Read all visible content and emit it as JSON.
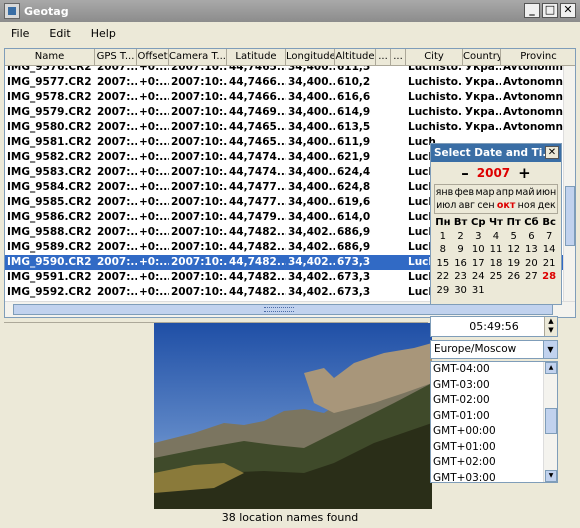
{
  "window": {
    "title": "Geotag",
    "minimize": "_",
    "maximize": "□",
    "close": "✕"
  },
  "menu": [
    "File",
    "Edit",
    "Help"
  ],
  "table": {
    "columns": [
      "Name",
      "GPS T...",
      "Offset",
      "Camera T...",
      "Latitude",
      "Longitude",
      "Altitude",
      "...",
      "...",
      "City",
      "Country",
      "Provinc"
    ],
    "rows": [
      [
        "IMG_9576.CR2",
        "2007:...",
        "+0:...",
        "2007:10:...",
        "44,7465...",
        "34,400...",
        "611,5",
        "",
        "",
        "Luchisto...",
        "Укра...",
        "Avtonomn"
      ],
      [
        "IMG_9577.CR2",
        "2007:...",
        "+0:...",
        "2007:10:...",
        "44,7466...",
        "34,400...",
        "610,2",
        "",
        "",
        "Luchisto...",
        "Укра...",
        "Avtonomn"
      ],
      [
        "IMG_9578.CR2",
        "2007:...",
        "+0:...",
        "2007:10:...",
        "44,7466...",
        "34,400...",
        "616,6",
        "",
        "",
        "Luchisto...",
        "Укра...",
        "Avtonomn"
      ],
      [
        "IMG_9579.CR2",
        "2007:...",
        "+0:...",
        "2007:10:...",
        "44,7469...",
        "34,400...",
        "614,9",
        "",
        "",
        "Luchisto...",
        "Укра...",
        "Avtonomn"
      ],
      [
        "IMG_9580.CR2",
        "2007:...",
        "+0:...",
        "2007:10:...",
        "44,7465...",
        "34,400...",
        "613,5",
        "",
        "",
        "Luchisto...",
        "Укра...",
        "Avtonomn"
      ],
      [
        "IMG_9581.CR2",
        "2007:...",
        "+0:...",
        "2007:10:...",
        "44,7465...",
        "34,400...",
        "611,9",
        "",
        "",
        "Luch",
        "",
        ""
      ],
      [
        "IMG_9582.CR2",
        "2007:...",
        "+0:...",
        "2007:10:...",
        "44,7474...",
        "34,400...",
        "621,9",
        "",
        "",
        "Luch",
        "",
        ""
      ],
      [
        "IMG_9583.CR2",
        "2007:...",
        "+0:...",
        "2007:10:...",
        "44,7474...",
        "34,400...",
        "624,4",
        "",
        "",
        "Luch",
        "",
        ""
      ],
      [
        "IMG_9584.CR2",
        "2007:...",
        "+0:...",
        "2007:10:...",
        "44,7477...",
        "34,400...",
        "624,8",
        "",
        "",
        "Luch",
        "",
        ""
      ],
      [
        "IMG_9585.CR2",
        "2007:...",
        "+0:...",
        "2007:10:...",
        "44,7477...",
        "34,400...",
        "619,6",
        "",
        "",
        "Luch",
        "",
        ""
      ],
      [
        "IMG_9586.CR2",
        "2007:...",
        "+0:...",
        "2007:10:...",
        "44,7479...",
        "34,400...",
        "614,0",
        "",
        "",
        "Luch",
        "",
        ""
      ],
      [
        "IMG_9588.CR2",
        "2007:...",
        "+0:...",
        "2007:10:...",
        "44,7482...",
        "34,402...",
        "686,9",
        "",
        "",
        "Luch",
        "",
        ""
      ],
      [
        "IMG_9589.CR2",
        "2007:...",
        "+0:...",
        "2007:10:...",
        "44,7482...",
        "34,402...",
        "686,9",
        "",
        "",
        "Luch",
        "",
        ""
      ],
      [
        "IMG_9590.CR2",
        "2007:...",
        "+0:...",
        "2007:10:...",
        "44,7482...",
        "34,402...",
        "673,3",
        "",
        "",
        "Luch",
        "",
        ""
      ],
      [
        "IMG_9591.CR2",
        "2007:...",
        "+0:...",
        "2007:10:...",
        "44,7482...",
        "34,402...",
        "673,3",
        "",
        "",
        "Luch",
        "",
        ""
      ],
      [
        "IMG_9592.CR2",
        "2007:...",
        "+0:...",
        "2007:10:...",
        "44,7482...",
        "34,402...",
        "673,3",
        "",
        "",
        "Luch",
        "",
        ""
      ]
    ],
    "selected_row": "IMG_9590.CR2"
  },
  "date_picker": {
    "title": "Select Date and Ti...",
    "close": "✕",
    "minus": "–",
    "year": "2007",
    "plus": "+",
    "months_row1": [
      "янв",
      "фев",
      "мар",
      "апр",
      "май",
      "июн"
    ],
    "months_row2": [
      "июл",
      "авг",
      "сен",
      "окт",
      "ноя",
      "дек"
    ],
    "current_month": "окт",
    "weekdays": [
      "Пн",
      "Вт",
      "Ср",
      "Чт",
      "Пт",
      "Сб",
      "Вс"
    ],
    "weeks": [
      [
        "1",
        "2",
        "3",
        "4",
        "5",
        "6",
        "7"
      ],
      [
        "8",
        "9",
        "10",
        "11",
        "12",
        "13",
        "14"
      ],
      [
        "15",
        "16",
        "17",
        "18",
        "19",
        "20",
        "21"
      ],
      [
        "22",
        "23",
        "24",
        "25",
        "26",
        "27",
        "28"
      ],
      [
        "29",
        "30",
        "31",
        "",
        "",
        "",
        ""
      ]
    ],
    "selected_day": "28"
  },
  "time_value": "05:49:56",
  "spin_up": "▲",
  "spin_down": "▼",
  "timezone": {
    "value": "Europe/Moscow",
    "arrow": "▼"
  },
  "gmt_list": [
    "GMT-04:00",
    "GMT-03:00",
    "GMT-02:00",
    "GMT-01:00",
    "GMT+00:00",
    "GMT+01:00",
    "GMT+02:00",
    "GMT+03:00"
  ],
  "status": "38 location names found",
  "colors": {
    "selection": "#316ac5",
    "accent_red": "#dd0000",
    "titlebar": "#8c8c8c"
  }
}
